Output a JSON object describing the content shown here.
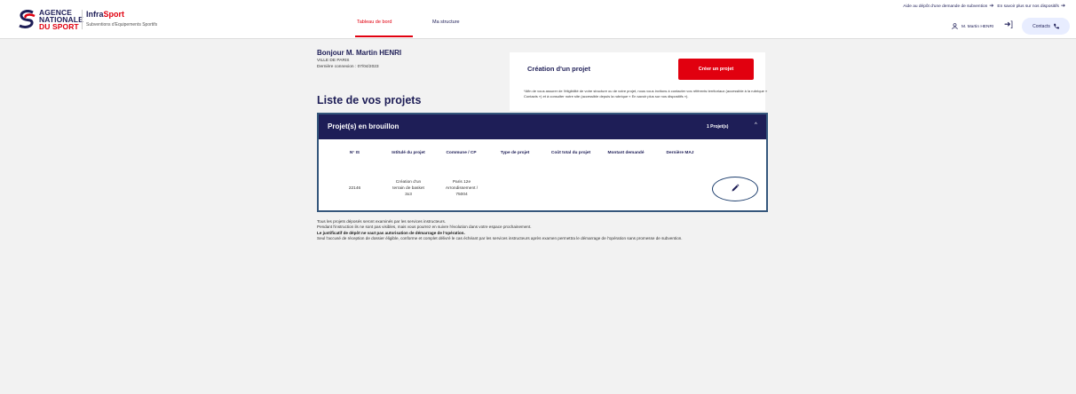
{
  "header": {
    "agency_lines": [
      "AGENCE",
      "NATIONALE",
      "DU SPORT"
    ],
    "brand_prefix": "Infra",
    "brand_suffix": "Sport",
    "brand_subtitle": "Subventions d'Equipements Sportifs",
    "nav": {
      "dashboard": "Tableau de bord",
      "my_structure": "Ma structure"
    },
    "top_link_1": "Aide au dépôt d'une demande de subvention",
    "top_link_2": "En savoir plus sur nos dispositifs",
    "user_name": "M. Martin HENRI",
    "contacts": "Contacts"
  },
  "greeting": {
    "hello": "Bonjour M. Martin HENRI",
    "city": "VILLE DE PARIS",
    "last_connection": "Dernière connexion : 07/04/2023"
  },
  "create_card": {
    "title": "Création d'un projet",
    "button": "Créer un projet",
    "note": "*Afin de vous assurer de l'éligibilité de votre structure ou de votre projet, nous vous invitons à contacter vos référents territoriaux (accessible à la rubrique « Contacts ») et à consulter notre site (accessible depuis la rubrique « En savoir plus sur nos dispositifs »)."
  },
  "list_title": "Liste de vos projets",
  "drafts": {
    "title": "Projet(s) en brouillon",
    "count": "1 Projet(s)",
    "columns": [
      "N° IS",
      "Intitulé du projet",
      "Commune / CP",
      "Type de projet",
      "Coût total du projet",
      "Montant demandé",
      "Dernière MAJ"
    ],
    "rows": [
      {
        "is_number": "22146",
        "title_lines": [
          "Création d'un",
          "terrain de basket",
          "3x3"
        ],
        "commune_lines": [
          "Paris 12e",
          "Arrondissement /",
          "75004"
        ]
      }
    ]
  },
  "notes": {
    "line1": "Tous les projets déposés seront examinés par les services instructeurs.",
    "line2": "Pendant l'instruction ils ne sont pas visibles, mais vous pourrez en suivre l'évolution dans votre espace prochainement.",
    "line3_bold": "Le justificatif de dépôt ne vaut pas autorisation de démarrage de l'opération.",
    "line4": "Seul l'accusé de réception de dossier éligible, conforme et complet délivré le cas échéant par les services instructeurs après examen permettra le démarrage de l'opération sans promesse de subvention."
  },
  "colors": {
    "brand_blue": "#1e1e57",
    "brand_red": "#e1000f",
    "highlight_border": "#35577c"
  },
  "icons": [
    "ans-logo-icon",
    "arrow-right-icon",
    "user-icon",
    "logout-icon",
    "phone-icon",
    "chevron-up-icon",
    "pencil-icon"
  ]
}
